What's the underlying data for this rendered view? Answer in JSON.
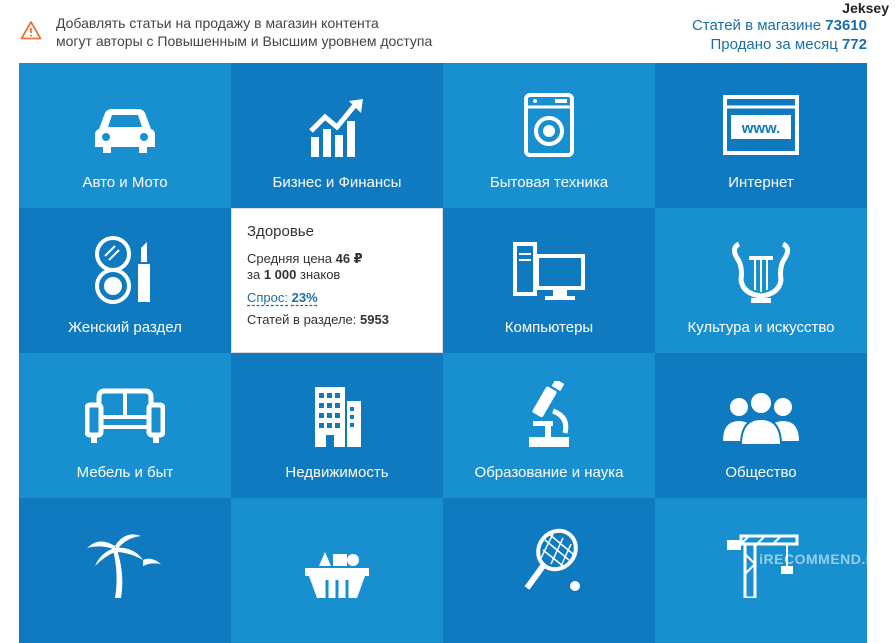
{
  "user": {
    "name": "Jeksey"
  },
  "notice": {
    "line1": "Добавлять статьи на продажу в магазин контента",
    "line2": "могут авторы с Повышенным и Высшим уровнем доступа"
  },
  "stats": {
    "in_store_label": "Статей в магазине",
    "in_store_value": "73610",
    "sold_label": "Продано за месяц",
    "sold_value": "772"
  },
  "info": {
    "title": "Здоровье",
    "price_label": "Средняя цена",
    "price_value": "46 ₽",
    "per_label": "за",
    "per_value": "1 000",
    "per_unit": "знаков",
    "demand_label": "Спрос:",
    "demand_value": "23%",
    "count_label": "Статей в разделе:",
    "count_value": "5953"
  },
  "tiles": {
    "auto": "Авто и Мото",
    "business": "Бизнес и Финансы",
    "appliances": "Бытовая техника",
    "internet": "Интернет",
    "women": "Женский раздел",
    "computers": "Компьютеры",
    "culture": "Культура и искусство",
    "furniture": "Мебель и быт",
    "realty": "Недвижимость",
    "education": "Образование и наука",
    "society": "Общество"
  },
  "watermark": "iRECOMMEND.RU",
  "colors": {
    "tile_light": "#1890d0",
    "tile_dark": "#0f7ac0",
    "accent": "#1a6fa8",
    "warning": "#e8743b"
  }
}
